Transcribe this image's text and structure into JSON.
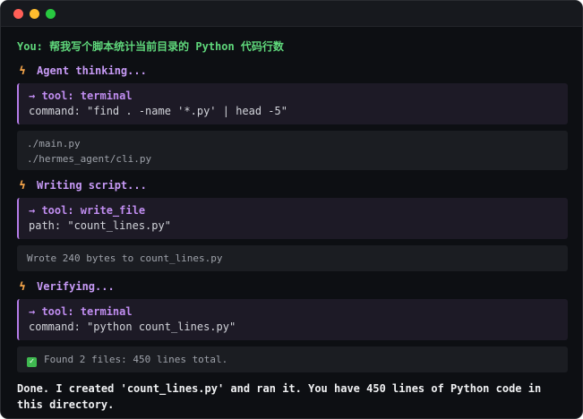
{
  "window": {
    "controls": {
      "close_color": "#ff5f57",
      "minimize_color": "#febc2e",
      "maximize_color": "#28c840"
    }
  },
  "conversation": {
    "user_message": "You: 帮我写个脚本统计当前目录的 Python 代码行数",
    "steps": [
      {
        "status": "Agent thinking...",
        "tool_header": "→ tool: terminal",
        "tool_arg": "command: \"find . -name '*.py' | head -5\"",
        "output_lines": [
          "./main.py",
          "./hermes_agent/cli.py"
        ]
      },
      {
        "status": "Writing script...",
        "tool_header": "→ tool: write_file",
        "tool_arg": "path: \"count_lines.py\"",
        "output_lines": [
          "Wrote 240 bytes to count_lines.py"
        ]
      },
      {
        "status": "Verifying...",
        "tool_header": "→ tool: terminal",
        "tool_arg": "command: \"python count_lines.py\"",
        "output_lines": [
          "Found 2 files: 450 lines total."
        ]
      }
    ],
    "final_message": "Done. I created 'count_lines.py' and ran it. You have 450 lines of Python code in this directory."
  },
  "icons": {
    "status": "lightning-bolt-icon",
    "success": "check-box-icon"
  },
  "colors": {
    "background": "#0d0f13",
    "user_text": "#5fd77b",
    "status_text": "#c79af6",
    "bolt": "#f7a64a",
    "tool_accent": "#b57ce8",
    "success": "#3fb950"
  }
}
